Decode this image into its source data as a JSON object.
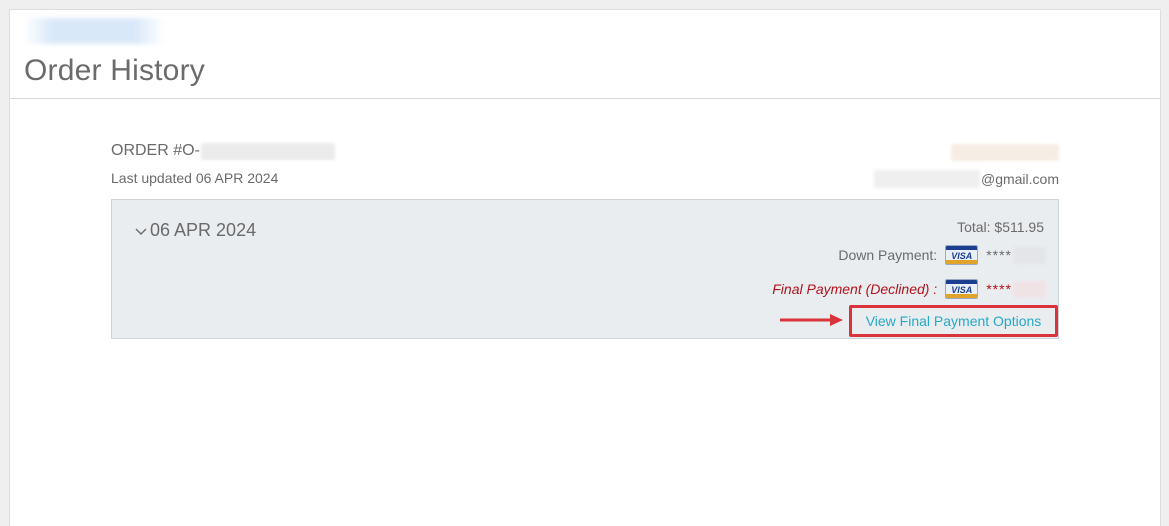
{
  "page": {
    "title": "Order History"
  },
  "order": {
    "number_prefix": "ORDER #O-",
    "last_updated": "Last updated 06 APR 2024",
    "email_suffix": "@gmail.com",
    "date": "06 APR 2024",
    "total": "Total: $511.95",
    "down_payment": {
      "label": "Down Payment:",
      "card_brand": "VISA",
      "masked": "****"
    },
    "final_payment": {
      "label": "Final Payment (Declined) :",
      "card_brand": "VISA",
      "masked": "****"
    },
    "view_options_label": "View Final Payment Options"
  },
  "colors": {
    "accent_link": "#25a8c8",
    "declined_text": "#b0121c",
    "highlight_box": "#d9343c",
    "panel_bg": "#eaedf0"
  },
  "icons": {
    "date_toggle": "chevron-down-icon",
    "card": "visa-card-icon",
    "annotation": "arrow-right-icon"
  }
}
